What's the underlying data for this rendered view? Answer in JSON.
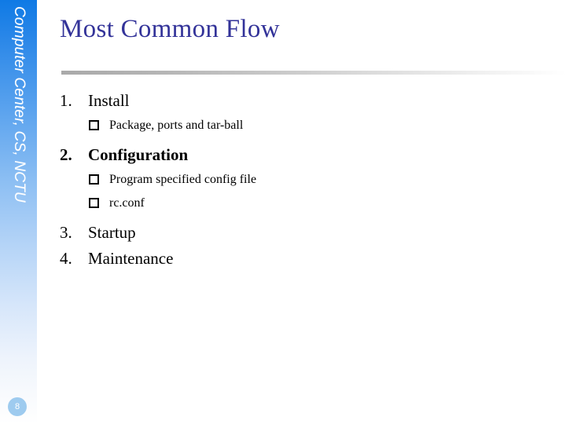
{
  "slide": {
    "title": "Most Common Flow",
    "page_number": "8",
    "sidebar_label": "Computer Center, CS, NCTU",
    "title_color": "#333399",
    "sidebar_top_color": "#0f7ae5",
    "sidebar_bottom_color": "#ffffff",
    "badge_color": "#9ecbef",
    "rule_color": "#a9a9a9"
  },
  "outline": [
    {
      "num": "1.",
      "text": "Install",
      "bold": false,
      "children": [
        {
          "bullet": "square-bullet-icon",
          "text": "Package, ports and tar-ball"
        }
      ]
    },
    {
      "num": "2.",
      "text": "Configuration",
      "bold": true,
      "children": [
        {
          "bullet": "square-bullet-icon",
          "text": "Program specified config file"
        },
        {
          "bullet": "square-bullet-icon",
          "text": "rc.conf"
        }
      ]
    },
    {
      "num": "3.",
      "text": "Startup",
      "bold": false,
      "children": []
    },
    {
      "num": "4.",
      "text": "Maintenance",
      "bold": false,
      "children": []
    }
  ]
}
